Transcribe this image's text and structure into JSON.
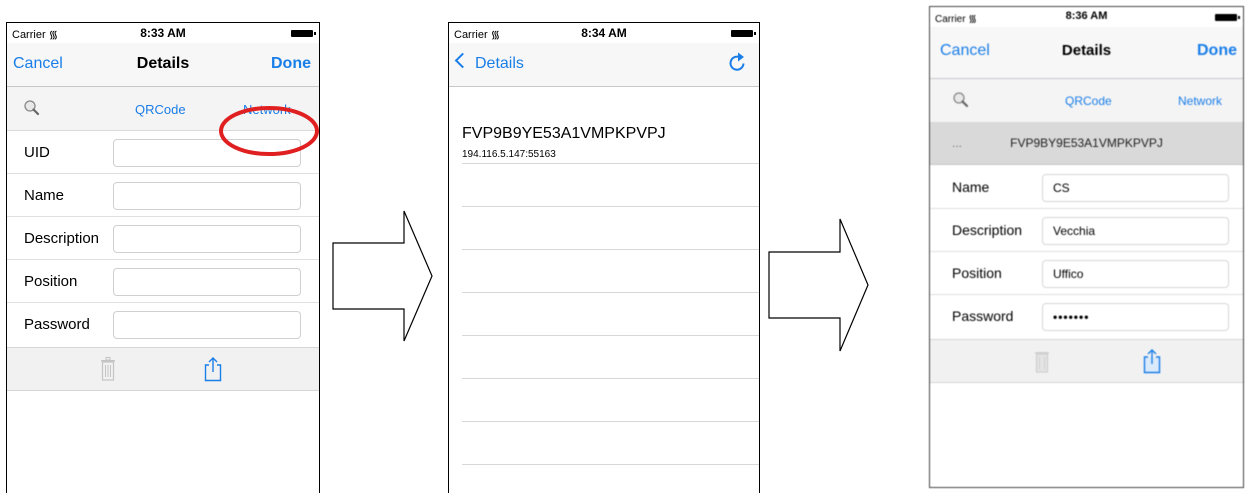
{
  "screens": [
    {
      "status": {
        "carrier": "Carrier",
        "time": "8:33 AM"
      },
      "nav": {
        "cancel": "Cancel",
        "title": "Details",
        "done": "Done"
      },
      "segments": {
        "qrcode": "QRCode",
        "network": "Network"
      },
      "fields": [
        {
          "label": "UID",
          "value": ""
        },
        {
          "label": "Name",
          "value": ""
        },
        {
          "label": "Description",
          "value": ""
        },
        {
          "label": "Position",
          "value": ""
        },
        {
          "label": "Password",
          "value": ""
        }
      ],
      "highlight_color": "#e02020"
    },
    {
      "status": {
        "carrier": "Carrier",
        "time": "8:34 AM"
      },
      "nav": {
        "back": "Details"
      },
      "device": {
        "uid": "FVP9B9YE53A1VMPKPVPJ",
        "address": "194.116.5.147:55163"
      }
    },
    {
      "status": {
        "carrier": "Carrier",
        "time": "8:36 AM"
      },
      "nav": {
        "cancel": "Cancel",
        "title": "Details",
        "done": "Done"
      },
      "segments": {
        "qrcode": "QRCode",
        "network": "Network"
      },
      "uid_row": {
        "dots": "...",
        "uid": "FVP9BY9E53A1VMPKPVPJ"
      },
      "fields": [
        {
          "label": "Name",
          "value": "CS"
        },
        {
          "label": "Description",
          "value": "Vecchia"
        },
        {
          "label": "Position",
          "value": "Uffico"
        },
        {
          "label": "Password",
          "value": "•••••••"
        }
      ]
    }
  ],
  "colors": {
    "accent": "#1a7ee8",
    "highlight": "#e02020"
  }
}
